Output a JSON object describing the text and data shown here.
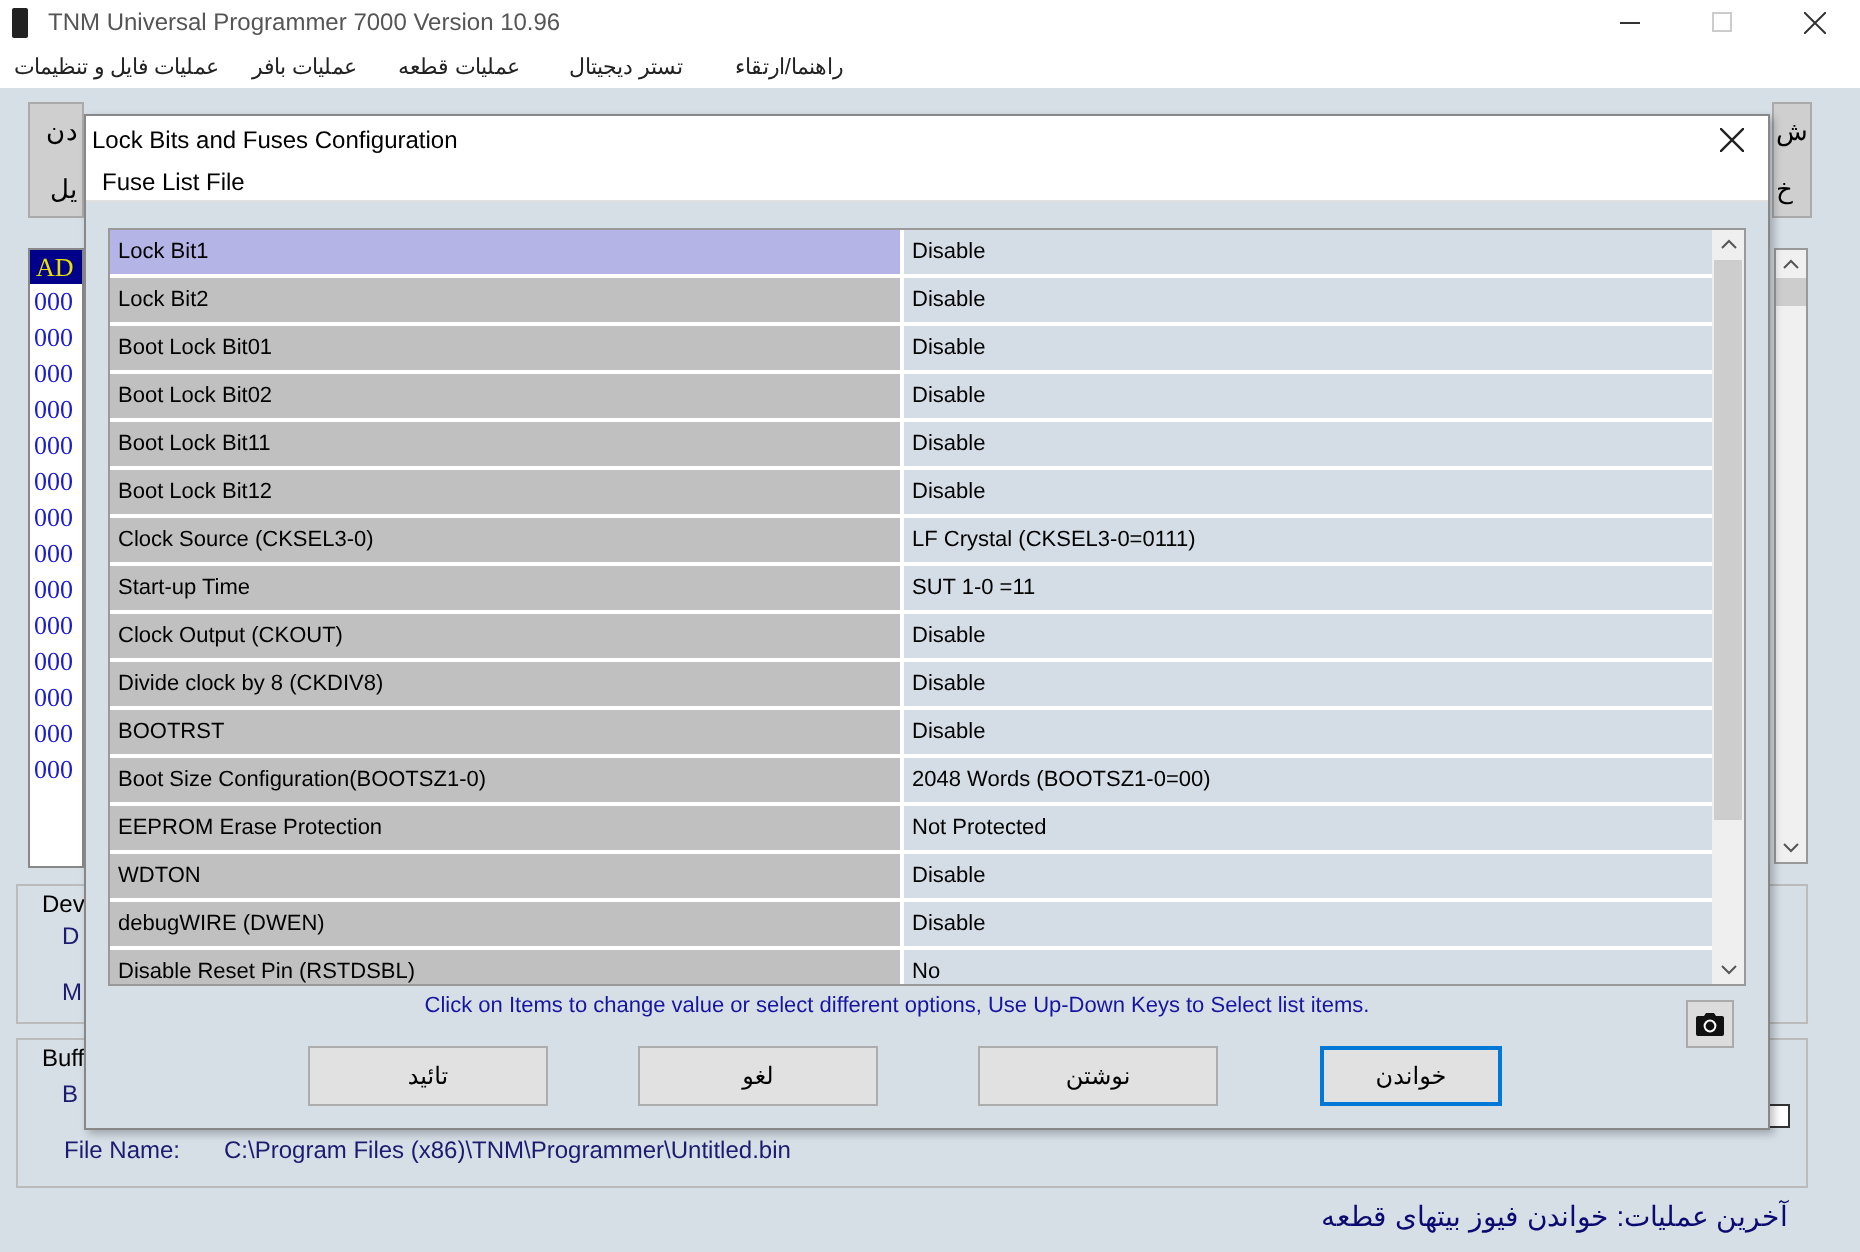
{
  "window": {
    "title": "TNM  Universal Programmer 7000   Version 10.96"
  },
  "menu": [
    {
      "label": "راهنما/ارتقاء"
    },
    {
      "label": "تستر دیجیتال"
    },
    {
      "label": "عملیات قطعه"
    },
    {
      "label": "عملیات بافر"
    },
    {
      "label": "عملیات فایل و تنظیمات"
    }
  ],
  "toolbar": {
    "left_button": {
      "top": "دن",
      "bottom": "یل"
    },
    "right_button": {
      "top": "ش",
      "bottom": "خ"
    }
  },
  "hex_view": {
    "header": "AD",
    "rows": [
      "000",
      "000",
      "000",
      "000",
      "000",
      "000",
      "000",
      "000",
      "000",
      "000",
      "000",
      "000",
      "000",
      "000"
    ]
  },
  "device_group": {
    "title": "Dev",
    "line_1": "D",
    "line_2": "M"
  },
  "buffer_group": {
    "title": "Buff",
    "line_1": "B",
    "checked": false,
    "file_name_label": "File Name:",
    "file_name": "C:\\Program Files (x86)\\TNM\\Programmer\\Untitled.bin"
  },
  "status": "آخرین عملیات:  خواندن فیوز بیتهای قطعه",
  "dialog": {
    "title": "Lock Bits and Fuses Configuration",
    "menu": "Fuse List File",
    "rows": [
      {
        "label": "Lock Bit1",
        "value": "Disable",
        "selected": true
      },
      {
        "label": "Lock Bit2",
        "value": "Disable",
        "selected": false
      },
      {
        "label": "Boot Lock Bit01",
        "value": "Disable",
        "selected": false
      },
      {
        "label": "Boot Lock Bit02",
        "value": "Disable",
        "selected": false
      },
      {
        "label": "Boot Lock Bit11",
        "value": "Disable",
        "selected": false
      },
      {
        "label": "Boot Lock Bit12",
        "value": "Disable",
        "selected": false
      },
      {
        "label": "Clock Source (CKSEL3-0)",
        "value": "LF Crystal (CKSEL3-0=0111)",
        "selected": false
      },
      {
        "label": "Start-up Time",
        "value": "SUT 1-0 =11",
        "selected": false
      },
      {
        "label": "Clock Output (CKOUT)",
        "value": "Disable",
        "selected": false
      },
      {
        "label": "Divide clock by 8 (CKDIV8)",
        "value": "Disable",
        "selected": false
      },
      {
        "label": "BOOTRST",
        "value": "Disable",
        "selected": false
      },
      {
        "label": "Boot Size Configuration(BOOTSZ1-0)",
        "value": "2048 Words (BOOTSZ1-0=00)",
        "selected": false
      },
      {
        "label": "EEPROM Erase Protection",
        "value": "Not Protected",
        "selected": false
      },
      {
        "label": "WDTON",
        "value": "Disable",
        "selected": false
      },
      {
        "label": "debugWIRE (DWEN)",
        "value": "Disable",
        "selected": false
      },
      {
        "label": "Disable Reset Pin  (RSTDSBL)",
        "value": "No",
        "selected": false
      }
    ],
    "hint": "Click on Items to change value or select different options, Use Up-Down Keys to Select list items.",
    "buttons": [
      {
        "label": "خواندن",
        "focused": true
      },
      {
        "label": "نوشتن",
        "focused": false
      },
      {
        "label": "لغو",
        "focused": false
      },
      {
        "label": "تائید",
        "focused": false
      }
    ]
  }
}
